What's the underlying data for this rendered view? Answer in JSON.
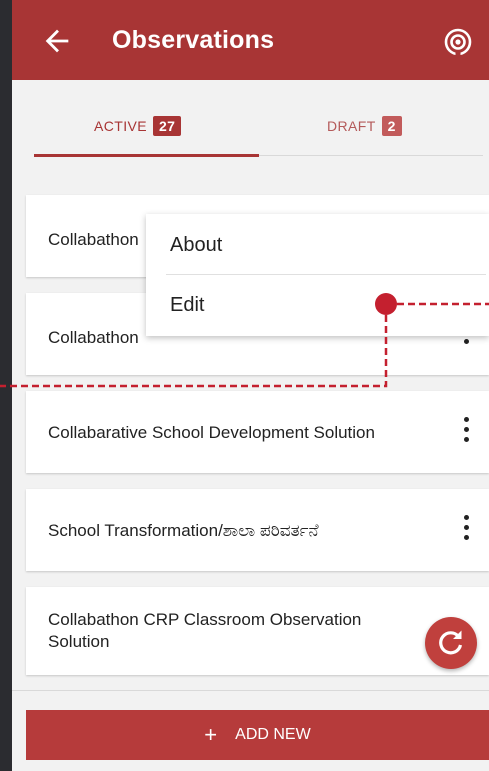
{
  "header": {
    "title": "Observations",
    "back_icon": "arrow-left-icon",
    "action_icon": "broadcast-icon"
  },
  "tabs": [
    {
      "label": "ACTIVE",
      "count": "27",
      "active": true
    },
    {
      "label": "DRAFT",
      "count": "2",
      "active": false
    }
  ],
  "list": [
    {
      "title": "Collabathon"
    },
    {
      "title": "Collabathon"
    },
    {
      "title": "Collabarative School Development Solution"
    },
    {
      "title": "School Transformation/ಶಾಲಾ ಪರಿವರ್ತನೆ"
    },
    {
      "title": "Collabathon CRP Classroom Observation Solution"
    }
  ],
  "context_menu": {
    "items": [
      {
        "label": "About"
      },
      {
        "label": "Edit"
      }
    ]
  },
  "fab": {
    "icon": "refresh-icon"
  },
  "footer": {
    "add_label": "ADD NEW",
    "add_icon": "plus-icon"
  },
  "colors": {
    "primary": "#a83535",
    "button": "#b63b3b",
    "annotation": "#c4202f",
    "background": "#f2f2f2"
  }
}
